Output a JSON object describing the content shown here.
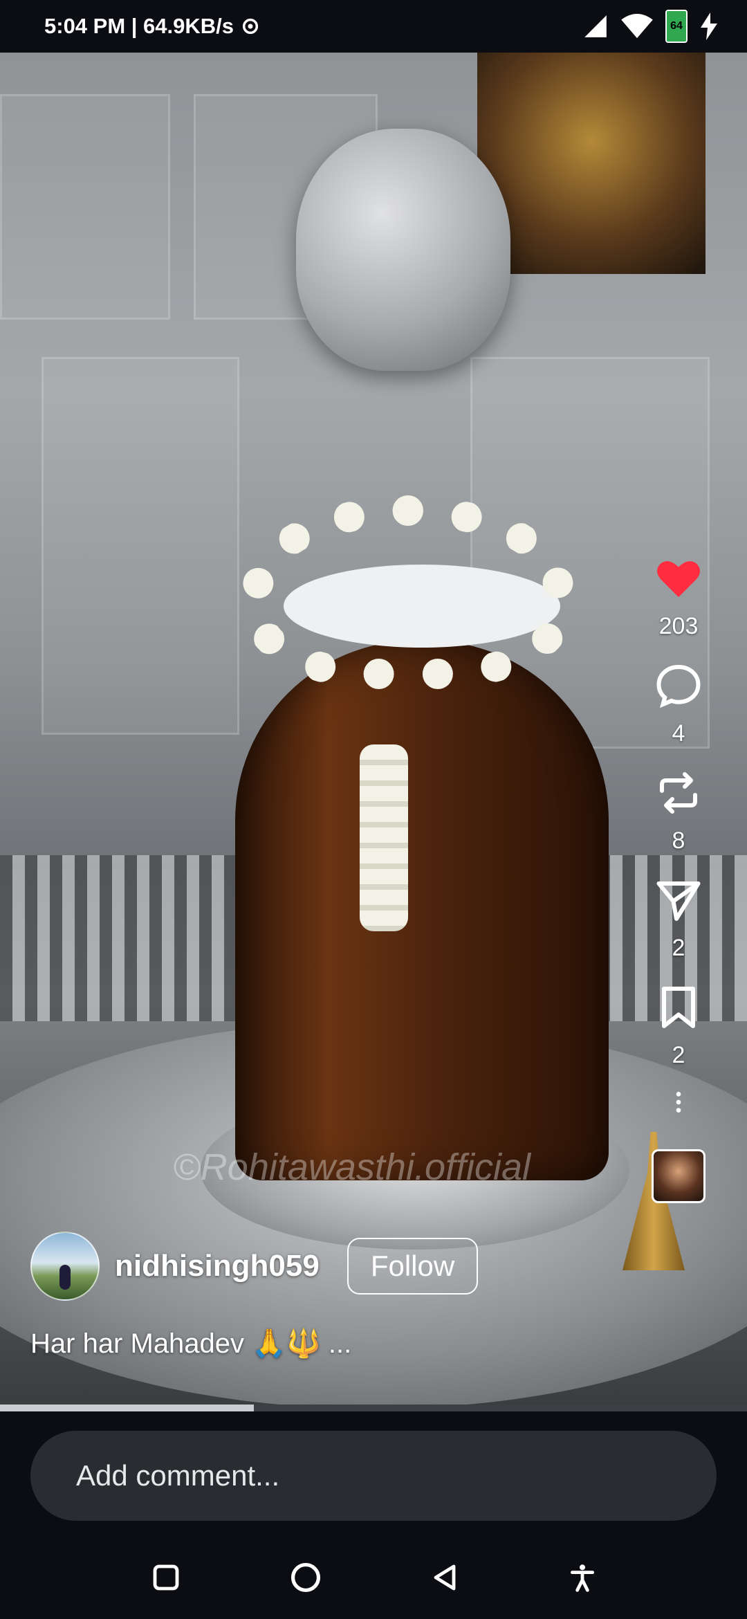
{
  "status_bar": {
    "time_speed": "5:04 PM | 64.9KB/s",
    "battery": "64"
  },
  "video": {
    "watermark": "©Rohitawasthi.official",
    "progress_fraction": 0.34
  },
  "actions": {
    "likes": "203",
    "comments": "4",
    "reposts": "8",
    "shares": "2",
    "saves": "2"
  },
  "post": {
    "username": "nidhisingh059",
    "follow_label": "Follow",
    "caption": "Har har Mahadev 🙏🔱 ..."
  },
  "comment": {
    "placeholder": "Add comment..."
  },
  "colors": {
    "like": "#ff2d3f",
    "background": "#0b0d12"
  },
  "icons": [
    "signal-icon",
    "wifi-icon",
    "battery-icon",
    "charging-icon",
    "heart-icon",
    "comment-icon",
    "repost-icon",
    "share-icon",
    "bookmark-icon",
    "more-icon",
    "recents-icon",
    "home-icon",
    "back-icon",
    "accessibility-icon"
  ]
}
